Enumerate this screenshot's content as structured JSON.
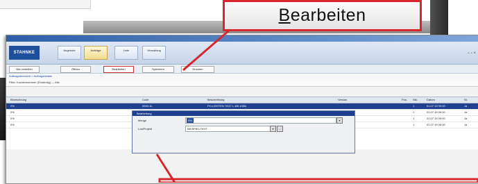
{
  "callout": {
    "label": "Bearbeiten"
  },
  "app": {
    "title": "STAHNKE",
    "tabs": [
      "Angebote",
      "Aufträge",
      "Liste",
      "Verwaltung"
    ],
    "toolbar": [
      "Neu erstellen",
      "Öffnen",
      "Bearbeiten",
      "Speichern",
      "Drucken"
    ],
    "breadcrumb": "Auftragsübersicht > Auftragsdetails",
    "filter": "Filter: Kundennummer (Eindeutig) — Alle",
    "columns": [
      "Bezeichnung",
      "Code",
      "Beschreibung",
      "Version",
      "Pos.",
      "Stk.",
      "Datum",
      "St."
    ],
    "rows": [
      [
        "0%",
        "0000-1L",
        "PO-LEISTEN 70/17 L-MK-K550",
        "",
        "1",
        "",
        "01.07.19 09:00",
        "Ja"
      ],
      [
        "0%",
        "0000-1L",
        "PO-LEISTEN 70/17 L-MK-K550",
        "",
        "1",
        "",
        "01.07.19 09:00",
        "Ja"
      ],
      [
        "0%",
        "0000-1L",
        "PO-LEISTEN 70/17 L-MK-K550",
        "",
        "1",
        "",
        "01.07.19 09:00",
        "Ja"
      ],
      [
        "0%",
        "0000-1L",
        "PO-LEISTEN 70/17 L-MK-K550",
        "",
        "1",
        "",
        "01.07.19 09:00",
        "Ja"
      ]
    ]
  },
  "dialog": {
    "title": "Bearbeitung",
    "field1_label": "Menge",
    "field1_value": "0%",
    "field2_label": "Los/Projekt",
    "field2_value": "BEISPIEL/TEXT"
  },
  "colors": {
    "callout_border": "#d7262e",
    "selection": "#1f3f8f"
  }
}
